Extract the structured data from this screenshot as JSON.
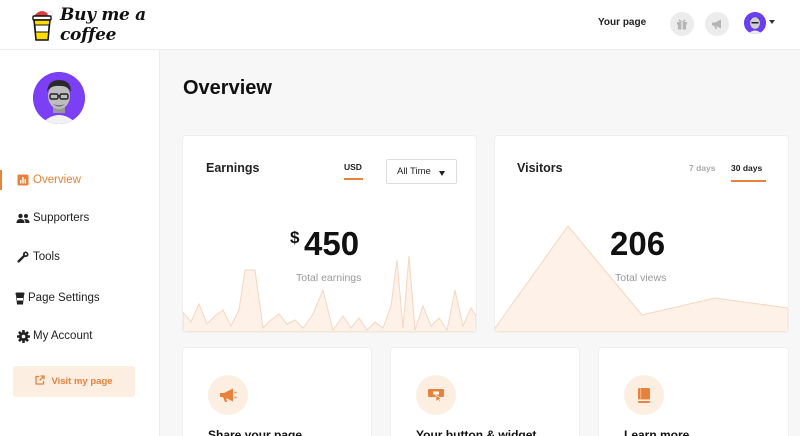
{
  "header": {
    "logo_text": "Buy me a coffee",
    "your_page": "Your page",
    "icons": [
      "gift-icon",
      "megaphone-icon"
    ]
  },
  "sidebar": {
    "items": [
      {
        "label": "Overview",
        "icon": "bar-chart-icon",
        "active": true
      },
      {
        "label": "Supporters",
        "icon": "users-icon",
        "active": false
      },
      {
        "label": "Tools",
        "icon": "wrench-icon",
        "active": false
      },
      {
        "label": "Page Settings",
        "icon": "cup-icon",
        "active": false
      },
      {
        "label": "My Account",
        "icon": "gear-icon",
        "active": false
      }
    ],
    "visit_button": "Visit my page"
  },
  "main": {
    "title": "Overview",
    "earnings": {
      "title": "Earnings",
      "currency_tab": "USD",
      "range_select": "All Time",
      "currency_symbol": "$",
      "amount": "450",
      "label": "Total earnings"
    },
    "visitors": {
      "title": "Visitors",
      "tabs": [
        "7 days",
        "30 days"
      ],
      "active_tab": "30 days",
      "count": "206",
      "label": "Total views"
    },
    "cards": [
      {
        "title": "Share your page",
        "icon": "megaphone-icon"
      },
      {
        "title": "Your button & widget",
        "icon": "widget-icon"
      },
      {
        "title": "Learn more",
        "icon": "book-icon"
      }
    ]
  },
  "colors": {
    "accent": "#e8823b",
    "accent_light": "#fdeee2",
    "chart_fill": "#fdf1e8",
    "chart_line": "#f6d6c0"
  }
}
